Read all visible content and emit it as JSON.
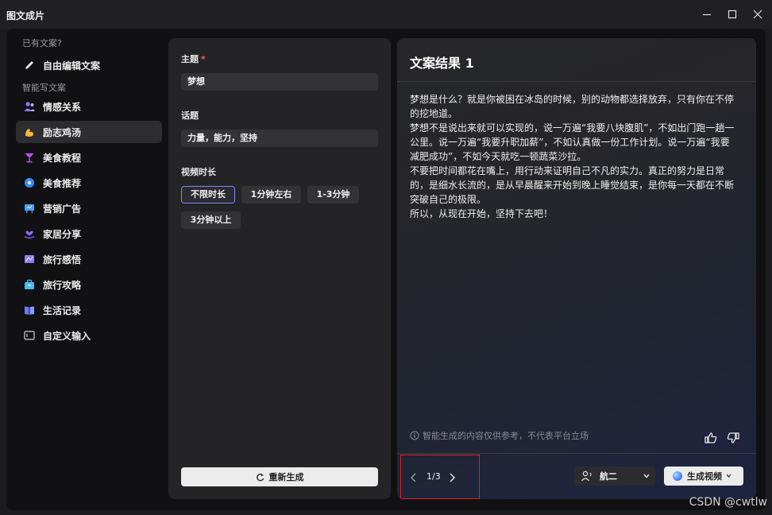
{
  "window": {
    "title": "图文成片"
  },
  "sidebar": {
    "group1_label": "已有文案?",
    "edit_item": "自由编辑文案",
    "group2_label": "智能写文案",
    "items": [
      {
        "label": "情感关系",
        "icon": "people-icon",
        "color": "#8a7cff"
      },
      {
        "label": "励志鸡汤",
        "icon": "flex-icon",
        "color": "#ffb43a"
      },
      {
        "label": "美食教程",
        "icon": "cocktail-icon",
        "color": "#c24cff"
      },
      {
        "label": "美食推荐",
        "icon": "gear-flower-icon",
        "color": "#3a8bff"
      },
      {
        "label": "营销广告",
        "icon": "billboard-icon",
        "color": "#4a9eff"
      },
      {
        "label": "家居分享",
        "icon": "hand-heart-icon",
        "color": "#7a4cff"
      },
      {
        "label": "旅行感悟",
        "icon": "map-icon",
        "color": "#8a7cff"
      },
      {
        "label": "旅行攻略",
        "icon": "suitcase-icon",
        "color": "#4ab8ff"
      },
      {
        "label": "生活记录",
        "icon": "book-icon",
        "color": "#6a7cff"
      },
      {
        "label": "自定义输入",
        "icon": "input-icon",
        "color": "#cfcfd6"
      }
    ]
  },
  "form": {
    "theme_label": "主题",
    "required_mark": "*",
    "theme_value": "梦想",
    "topic_label": "话题",
    "topic_value": "力量，能力，坚持",
    "duration_label": "视频时长",
    "durations": [
      "不限时长",
      "1分钟左右",
      "1-3分钟",
      "3分钟以上"
    ],
    "regen_label": "重新生成"
  },
  "result": {
    "title": "文案结果 1",
    "paragraphs": [
      "梦想是什么？就是你被困在冰岛的时候，别的动物都选择放弃，只有你在不停的挖地道。",
      "梦想不是说出来就可以实现的，说一万遍“我要八块腹肌”，不如出门跑一趟一公里。说一万遍“我要升职加薪”，不如认真做一份工作计划。说一万遍“我要减肥成功”，不如今天就吃一顿蔬菜沙拉。",
      "不要把时间都花在嘴上，用行动来证明自己不凡的实力。真正的努力是日常的，是细水长流的，是从早晨醒来开始到晚上睡觉结束，是你每一天都在不断突破自己的极限。",
      "所以，从现在开始，坚持下去吧！"
    ],
    "disclaimer": "智能生成的内容仅供参考，不代表平台立场",
    "page": "1/3",
    "voice": "航二",
    "generate_label": "生成视频"
  },
  "watermark": "CSDN @cwtlw"
}
